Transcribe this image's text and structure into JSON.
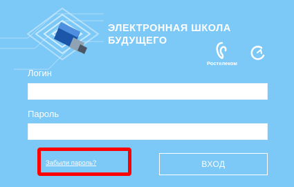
{
  "brand": {
    "title_line1": "ЭЛЕКТРОННАЯ ШКОЛА",
    "title_line2": "БУДУЩЕГО",
    "partner_label": "Ростелеком"
  },
  "form": {
    "login_label": "Логин",
    "login_value": "",
    "password_label": "Пароль",
    "password_value": "",
    "forgot_link": "Забыли пароль?",
    "submit_label": "ВХОД"
  },
  "colors": {
    "background": "#7cc8f6",
    "highlight_box": "#ff0000"
  },
  "icons": [
    "usb-stick-logo-icon",
    "rostelecom-logo-icon",
    "partner-logo-icon"
  ]
}
